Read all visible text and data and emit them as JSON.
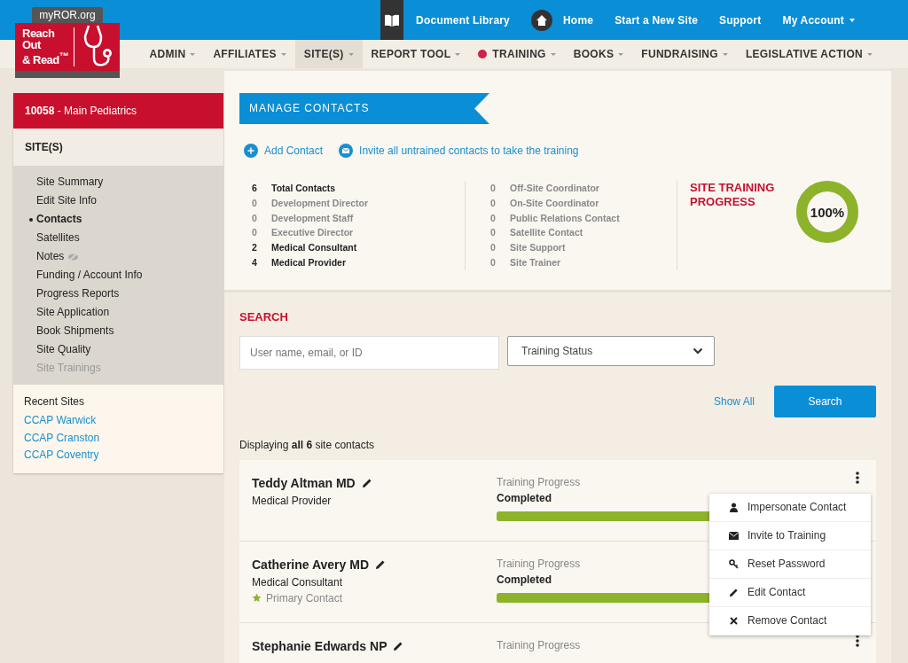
{
  "logo": {
    "tag": "myROR.org",
    "lines": [
      "Reach",
      "Out",
      "& Read$^{™}$"
    ]
  },
  "top_links": [
    {
      "label": "Document Library",
      "kind": "book"
    },
    {
      "label": "Home",
      "kind": "home"
    },
    {
      "label": "Start a New Site",
      "kind": "plain"
    },
    {
      "label": "Support",
      "kind": "plain"
    },
    {
      "label": "My Account",
      "kind": "dropdown"
    }
  ],
  "nav": [
    {
      "label": "ADMIN",
      "selected": false,
      "dot": false
    },
    {
      "label": "AFFILIATES",
      "selected": false,
      "dot": false
    },
    {
      "label": "SITE(S)",
      "selected": true,
      "dot": false
    },
    {
      "label": "REPORT TOOL",
      "selected": false,
      "dot": false
    },
    {
      "label": "TRAINING",
      "selected": false,
      "dot": true
    },
    {
      "label": "BOOKS",
      "selected": false,
      "dot": false
    },
    {
      "label": "FUNDRAISING",
      "selected": false,
      "dot": false
    },
    {
      "label": "LEGISLATIVE ACTION",
      "selected": false,
      "dot": false
    }
  ],
  "sidebar": {
    "site_id": "10058",
    "site_name": "- Main Pediatrics",
    "section": "SITE(S)",
    "items": [
      {
        "label": "Site Summary",
        "selected": false,
        "disabled": false
      },
      {
        "label": "Edit Site Info",
        "selected": false,
        "disabled": false
      },
      {
        "label": "Contacts",
        "selected": true,
        "disabled": false
      },
      {
        "label": "Satellites",
        "selected": false,
        "disabled": false
      },
      {
        "label": "Notes",
        "selected": false,
        "disabled": false,
        "hidden_icon": true
      },
      {
        "label": "Funding / Account Info",
        "selected": false,
        "disabled": false
      },
      {
        "label": "Progress Reports",
        "selected": false,
        "disabled": false
      },
      {
        "label": "Site Application",
        "selected": false,
        "disabled": false
      },
      {
        "label": "Book Shipments",
        "selected": false,
        "disabled": false
      },
      {
        "label": "Site Quality",
        "selected": false,
        "disabled": false
      },
      {
        "label": "Site Trainings",
        "selected": false,
        "disabled": true
      }
    ],
    "recent_title": "Recent Sites",
    "recent": [
      "CCAP Warwick",
      "CCAP Cranston",
      "CCAP Coventry"
    ]
  },
  "manage": {
    "title": "MANAGE CONTACTS",
    "actions": [
      {
        "label": "Add Contact",
        "kind": "add"
      },
      {
        "label": "Invite all untrained contacts to take the training",
        "kind": "mail"
      }
    ],
    "stats_left": [
      {
        "count": "6",
        "label": "Total Contacts",
        "active": true
      },
      {
        "count": "0",
        "label": "Development Director",
        "active": false
      },
      {
        "count": "0",
        "label": "Development Staff",
        "active": false
      },
      {
        "count": "0",
        "label": "Executive Director",
        "active": false
      },
      {
        "count": "2",
        "label": "Medical Consultant",
        "active": true
      },
      {
        "count": "4",
        "label": "Medical Provider",
        "active": true
      }
    ],
    "stats_right": [
      {
        "count": "0",
        "label": "Off-Site Coordinator",
        "active": false
      },
      {
        "count": "0",
        "label": "On-Site Coordinator",
        "active": false
      },
      {
        "count": "0",
        "label": "Public Relations Contact",
        "active": false
      },
      {
        "count": "0",
        "label": "Satellite Contact",
        "active": false
      },
      {
        "count": "0",
        "label": "Site Support",
        "active": false
      },
      {
        "count": "0",
        "label": "Site Trainer",
        "active": false
      }
    ],
    "progress_title": "SITE TRAINING PROGRESS",
    "progress_value": "100%",
    "level": 1
  },
  "search": {
    "title": "SEARCH",
    "placeholder": "User name, email, or ID",
    "status_select": "Training Status",
    "show_all": "Show All",
    "button": "Search",
    "summary": "Displaying **all 6** site contacts"
  },
  "contacts": [
    {
      "name": "Teddy Altman MD",
      "role": "Medical Provider",
      "primary": false,
      "menu_open": true,
      "progress_label": "Training Progress",
      "status": "Completed",
      "level": 1
    },
    {
      "name": "Catherine Avery MD",
      "role": "Medical Consultant",
      "primary": true,
      "menu_open": false,
      "primary_label": "Primary Contact",
      "progress_label": "Training Progress",
      "status": "Completed",
      "level": 1
    },
    {
      "name": "Stephanie Edwards NP",
      "menu_open": false,
      "progress_label": "Training Progress"
    }
  ],
  "contact_menu": [
    {
      "label": "Impersonate Contact",
      "kind": "user"
    },
    {
      "label": "Invite to Training",
      "kind": "mail"
    },
    {
      "label": "Reset Password",
      "kind": "key"
    },
    {
      "label": "Edit Contact",
      "kind": "pencil"
    },
    {
      "label": "Remove Contact",
      "kind": "cross"
    }
  ]
}
